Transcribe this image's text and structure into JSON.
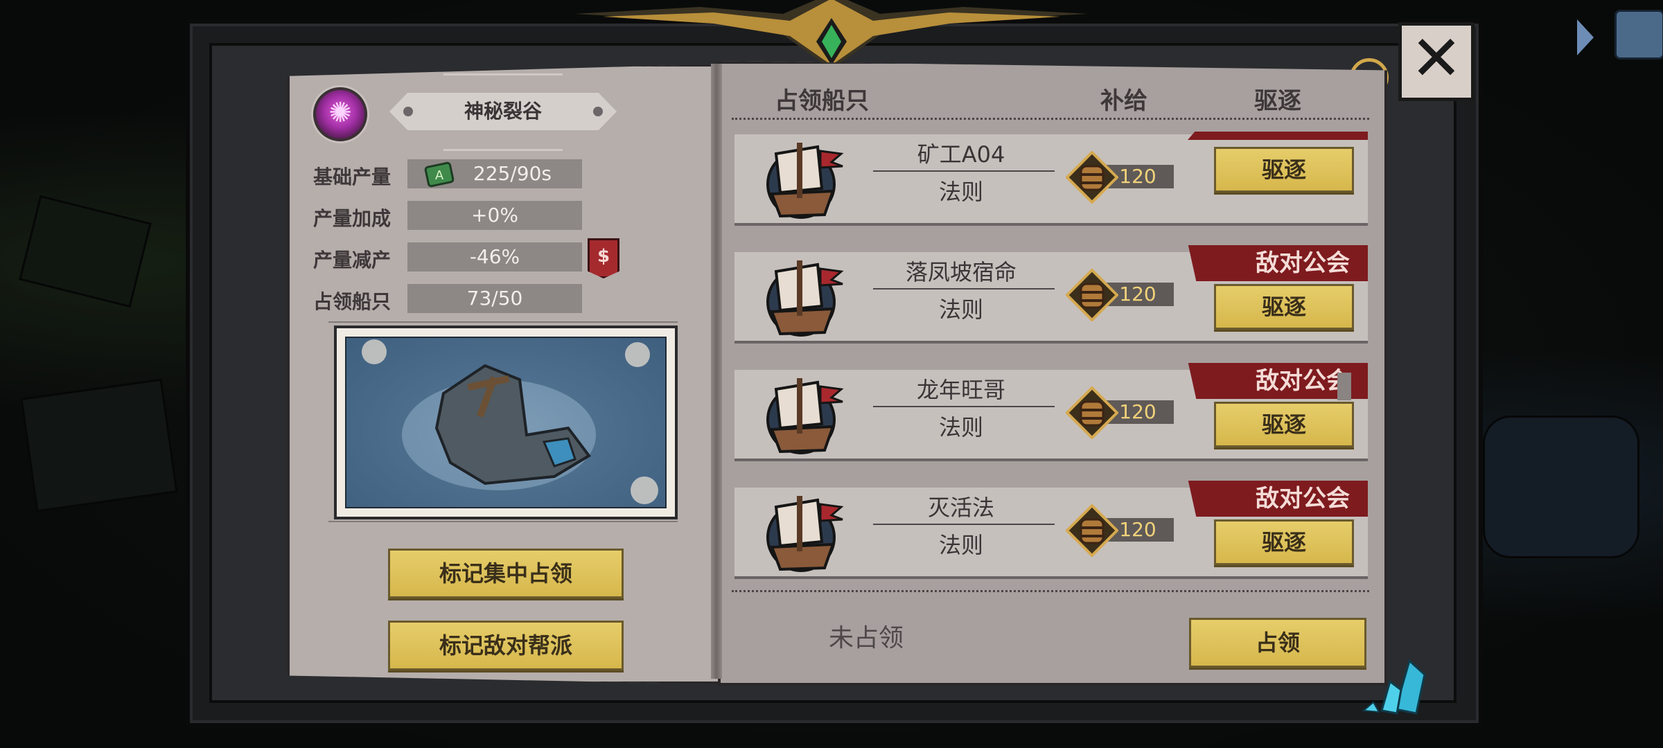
{
  "territory": {
    "name": "神秘裂谷",
    "icon": "purple-crystal-gem-icon"
  },
  "stats": [
    {
      "label": "基础产量",
      "value": "225/90s",
      "icon": "resource-scroll-icon"
    },
    {
      "label": "产量加成",
      "value": "+0%"
    },
    {
      "label": "产量减产",
      "value": "-46%",
      "icon": "dollar-tag-icon",
      "icon_text": "$"
    },
    {
      "label": "占领船只",
      "value": "73/50"
    }
  ],
  "buttons": {
    "mark_focus": "标记集中占领",
    "mark_hostile": "标记敌对帮派"
  },
  "table": {
    "headers": {
      "ships": "占领船只",
      "supply": "补给",
      "evict": "驱逐"
    },
    "rows": [
      {
        "name": "矿工A04",
        "subtitle": "法则",
        "supply": "120",
        "evict": "驱逐",
        "hostile": ""
      },
      {
        "name": "落凤坡宿命",
        "subtitle": "法则",
        "supply": "120",
        "evict": "驱逐",
        "hostile": "敌对公会"
      },
      {
        "name": "龙年旺哥",
        "subtitle": "法则",
        "supply": "120",
        "evict": "驱逐",
        "hostile": "敌对公会"
      },
      {
        "name": "灭活法",
        "subtitle": "法则",
        "supply": "120",
        "evict": "驱逐",
        "hostile": "敌对公会"
      }
    ]
  },
  "unoccupied": {
    "label": "未占领",
    "action": "占领"
  },
  "close_symbol": "✕",
  "colors": {
    "gold": "#d6b74c",
    "hostile_red": "#7e1b1f",
    "supply_text": "#f1d27a",
    "page": "#b5aeab"
  }
}
